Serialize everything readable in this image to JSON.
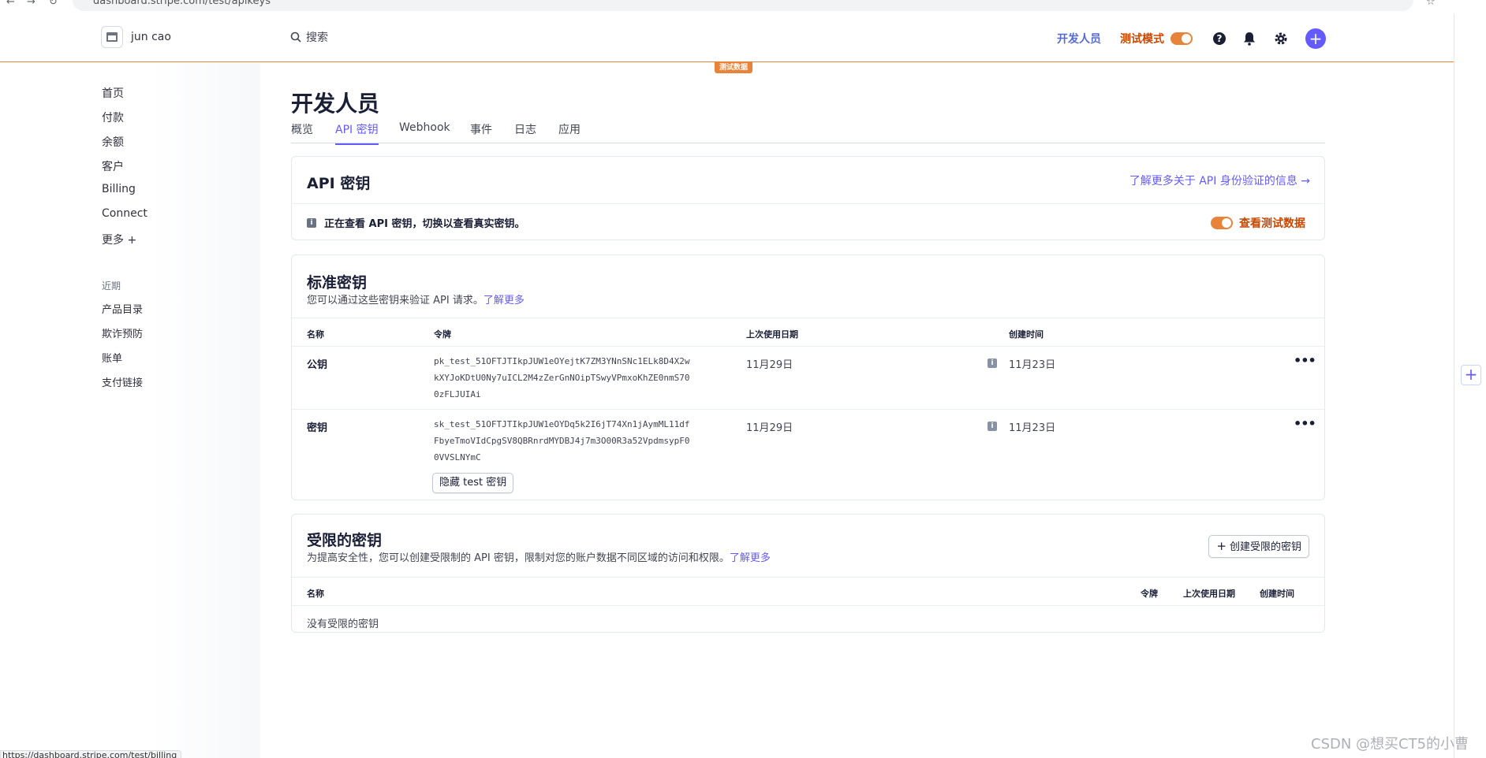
{
  "browser": {
    "url": "dashboard.stripe.com/test/apikeys"
  },
  "header": {
    "account_name": "jun cao",
    "search_placeholder": "搜索",
    "developers_link": "开发人员",
    "test_mode_label": "测试模式",
    "test_data_badge": "测试数据",
    "accent_color": "#635bff",
    "test_color": "#e8833a"
  },
  "sidebar": {
    "items": [
      {
        "label": "首页"
      },
      {
        "label": "付款"
      },
      {
        "label": "余额"
      },
      {
        "label": "客户"
      },
      {
        "label": "Billing"
      },
      {
        "label": "Connect"
      },
      {
        "label": "更多 +"
      }
    ],
    "recent_heading": "近期",
    "recent_items": [
      {
        "label": "产品目录"
      },
      {
        "label": "欺诈预防"
      },
      {
        "label": "账单"
      },
      {
        "label": "支付链接"
      }
    ]
  },
  "page": {
    "title": "开发人员",
    "tabs": [
      {
        "label": "概览",
        "active": false
      },
      {
        "label": "API 密钥",
        "active": true
      },
      {
        "label": "Webhook",
        "active": false
      },
      {
        "label": "事件",
        "active": false
      },
      {
        "label": "日志",
        "active": false
      },
      {
        "label": "应用",
        "active": false
      }
    ]
  },
  "api_keys_card": {
    "title": "API 密钥",
    "learn_more": "了解更多关于 API 身份验证的信息 →",
    "info_text": "正在查看 API 密钥，切换以查看真实密钥。",
    "view_test_data": "查看测试数据"
  },
  "standard_keys": {
    "title": "标准密钥",
    "subtitle": "您可以通过这些密钥来验证 API 请求。",
    "subtitle_link": "了解更多",
    "columns": {
      "name": "名称",
      "token": "令牌",
      "last_used": "上次使用日期",
      "created": "创建时间"
    },
    "rows": [
      {
        "name": "公钥",
        "token": "pk_test_51OFTJTIkpJUW1eOYejtK7ZM3YNnSNc1ELk8D4X2wkXYJoKDtU0Ny7uICL2M4zZerGnNOipTSwyVPmxoKhZE0nmS700zFLJUIAi",
        "last_used": "11月29日",
        "created": "11月23日"
      },
      {
        "name": "密钥",
        "token": "sk_test_51OFTJTIkpJUW1eOYDq5k2I6jT74Xn1jAymML11dfFbyeTmoVIdCpgSV8QBRnrdMYDBJ4j7m3O00R3a52VpdmsypF00VVSLNYmC",
        "last_used": "11月29日",
        "created": "11月23日"
      }
    ],
    "hide_button": "隐藏 test 密钥"
  },
  "restricted_keys": {
    "title": "受限的密钥",
    "subtitle": "为提高安全性，您可以创建受限制的 API 密钥，限制对您的账户数据不同区域的访问和权限。",
    "subtitle_link": "了解更多",
    "create_button": "创建受限的密钥",
    "columns": {
      "name": "名称",
      "token": "令牌",
      "last_used": "上次使用日期",
      "created": "创建时间"
    },
    "empty_text": "没有受限的密钥"
  },
  "status_bar": {
    "url": "https://dashboard.stripe.com/test/billing"
  },
  "watermark": "CSDN @想买CT5的小曹"
}
